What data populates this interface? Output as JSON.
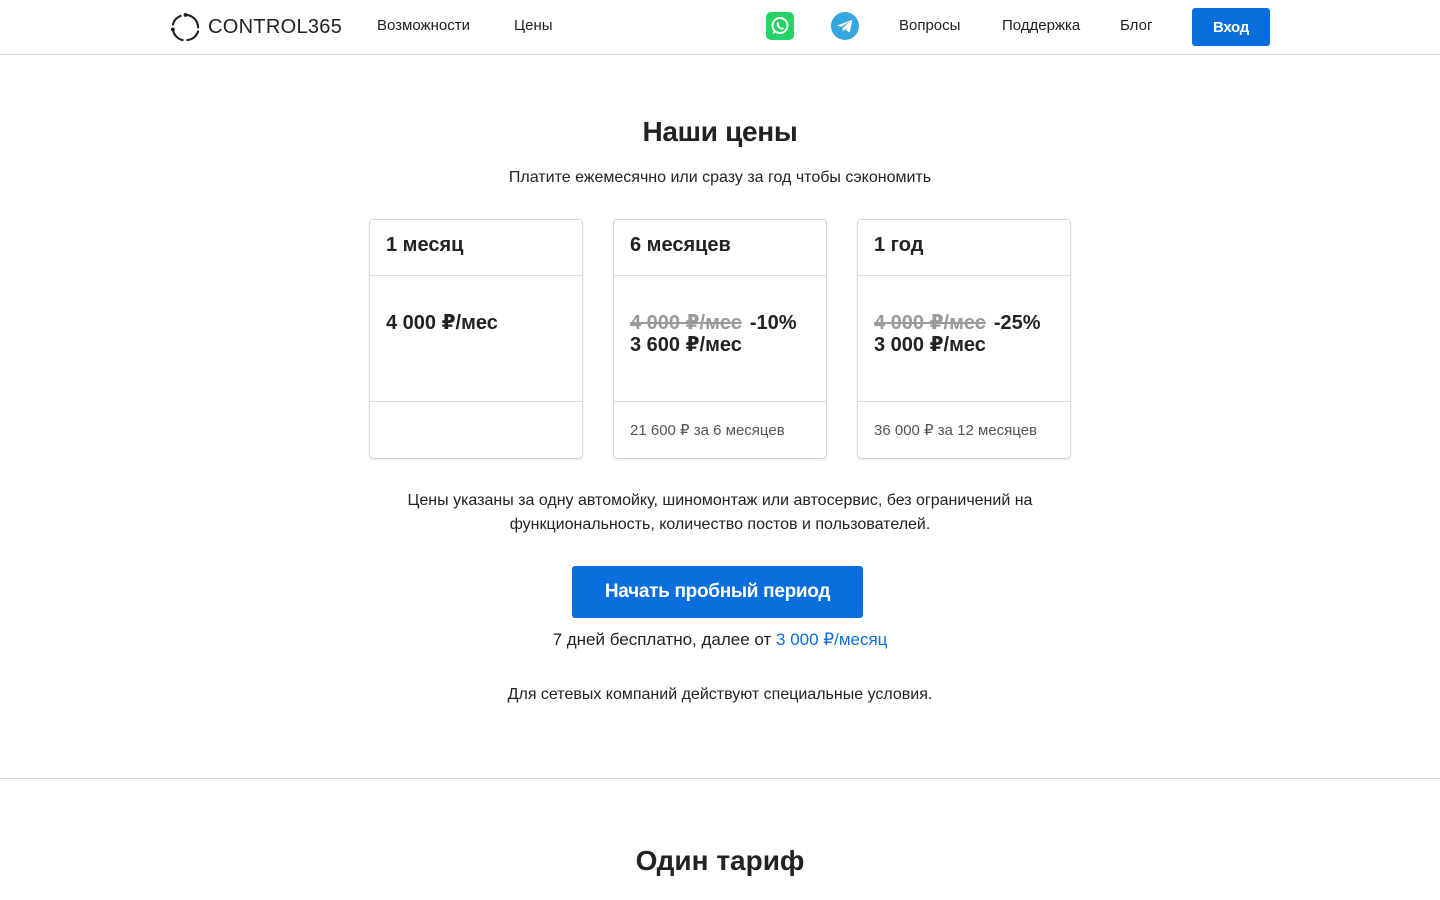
{
  "header": {
    "logo_text": "CONTROL365",
    "nav_left": [
      "Возможности",
      "Цены"
    ],
    "nav_right": [
      "Вопросы",
      "Поддержка",
      "Блог"
    ],
    "login_label": "Вход",
    "social_icons": [
      "whatsapp-icon",
      "telegram-icon"
    ],
    "colors": {
      "whatsapp": "#25d366",
      "telegram": "#35a6de",
      "accent": "#0a6fdc"
    }
  },
  "pricing": {
    "title": "Наши цены",
    "subtitle": "Платите ежемесячно или сразу за год чтобы сэкономить",
    "plans": [
      {
        "name": "1 месяц",
        "old_price": "",
        "discount": "",
        "price": "4 000 ₽/мес",
        "total": ""
      },
      {
        "name": "6 месяцев",
        "old_price": "4 000 ₽/мес",
        "discount": "-10%",
        "price": "3 600 ₽/мес",
        "total": "21 600 ₽ за 6 месяцев"
      },
      {
        "name": "1 год",
        "old_price": "4 000 ₽/мес",
        "discount": "-25%",
        "price": "3 000 ₽/мес",
        "total": "36 000 ₽ за 12 месяцев"
      }
    ],
    "note": "Цены указаны за одну автомойку, шиномонтаж или автосервис, без ограничений на функциональность, количество постов и пользователей.",
    "trial_button": "Начать пробный период",
    "trial_info_prefix": "7 дней бесплатно, далее от ",
    "trial_info_link": "3 000 ₽/месяц",
    "network_note": "Для сетевых компаний действуют специальные условия."
  },
  "tariff": {
    "title": "Один тариф"
  }
}
